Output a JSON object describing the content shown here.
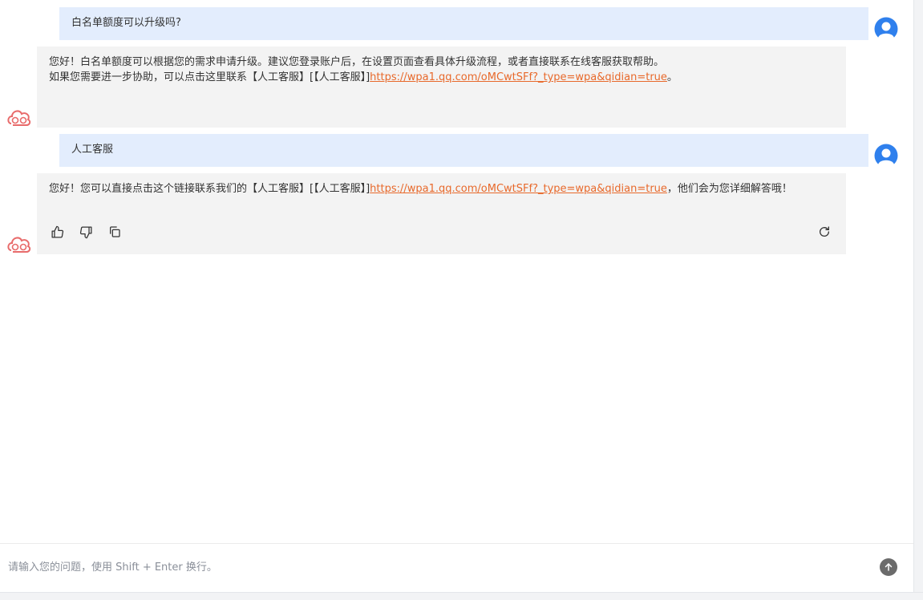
{
  "conversation": {
    "messages": [
      {
        "role": "user",
        "text": "白名单额度可以升级吗?"
      },
      {
        "role": "assistant",
        "line1": "您好！白名单额度可以根据您的需求申请升级。建议您登录账户后，在设置页面查看具体升级流程，或者直接联系在线客服获取帮助。",
        "line2_prefix": "如果您需要进一步协助，可以点击这里联系【人工客服】[【人工客服】]",
        "link": "https://wpa1.qq.com/oMCwtSFf?_type=wpa&qidian=true",
        "line2_suffix": "。"
      },
      {
        "role": "user",
        "text": "人工客服"
      },
      {
        "role": "assistant",
        "prefix": "您好！您可以直接点击这个链接联系我们的【人工客服】[【人工客服】]",
        "link": "https://wpa1.qq.com/oMCwtSFf?_type=wpa&qidian=true",
        "suffix": "，他们会为您详细解答哦！"
      }
    ],
    "message_actions": {
      "icons": [
        "thumbs-up-icon",
        "thumbs-down-icon",
        "copy-icon",
        "refresh-icon"
      ]
    }
  },
  "input": {
    "placeholder": "请输入您的问题，使用 Shift + Enter 换行。",
    "value": ""
  },
  "colors": {
    "user_bubble": "#e3edfd",
    "bot_bubble": "#f3f3f3",
    "link": "#e8692b",
    "send_button": "#6b6b6b",
    "user_avatar": "#2f80ed",
    "bot_logo": "#e86b6b"
  }
}
